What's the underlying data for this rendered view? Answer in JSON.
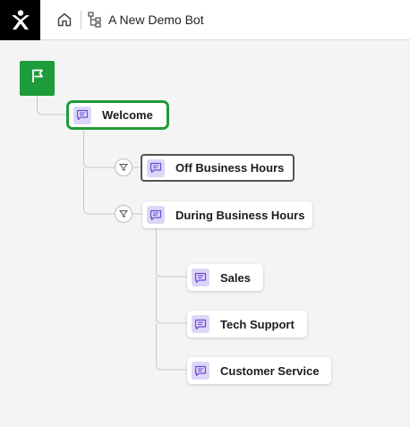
{
  "header": {
    "bot_title": "A New Demo Bot",
    "logo_icon": "brand-logo-icon",
    "home_icon": "home-icon",
    "flow_icon": "flow-tree-icon"
  },
  "flow": {
    "start_icon": "flag-icon",
    "filter_icon": "filter-icon",
    "message_icon": "chat-message-icon",
    "nodes": {
      "welcome": "Welcome",
      "off_hours": "Off Business Hours",
      "during_hours": "During Business Hours",
      "sales": "Sales",
      "tech_support": "Tech Support",
      "customer_service": "Customer Service"
    }
  },
  "colors": {
    "start_green": "#1f9c3a",
    "selected_border": "#1f9c3a",
    "icon_bg": "#ddd6f7",
    "icon_purple": "#6b4fd6",
    "connector": "#c8c8c8"
  }
}
